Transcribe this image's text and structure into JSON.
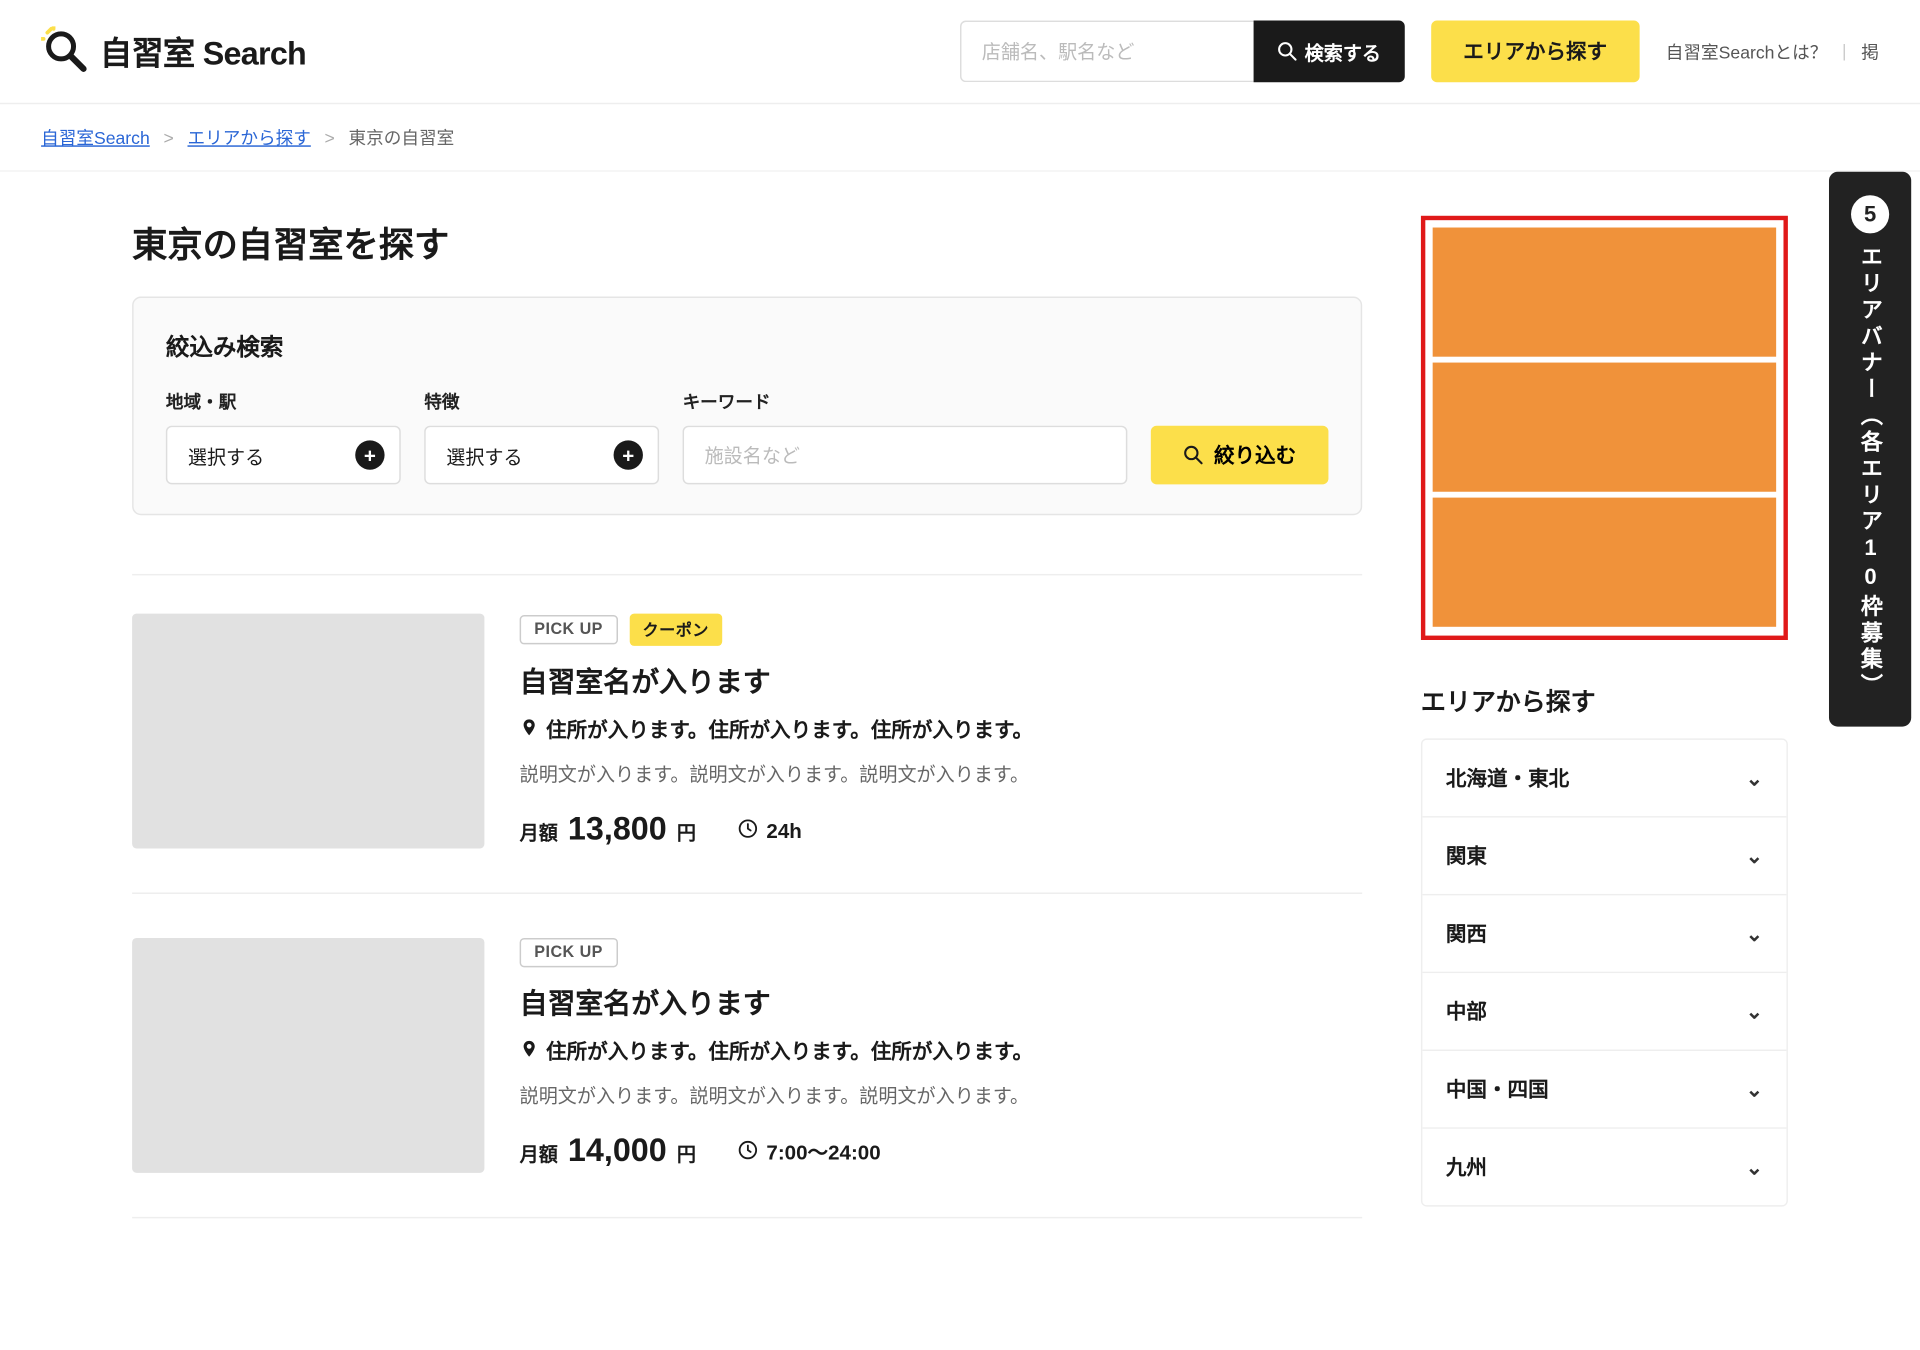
{
  "header": {
    "logo_text": "自習室 Search",
    "search_placeholder": "店舗名、駅名など",
    "search_button": "検索する",
    "area_button": "エリアから探す",
    "nav_about": "自習室Searchとは？",
    "nav_post": "掲"
  },
  "breadcrumb": {
    "home": "自習室Search",
    "area": "エリアから探す",
    "current": "東京の自習室"
  },
  "page_title": "東京の自習室を探す",
  "filter": {
    "title": "絞込み検索",
    "field_area_label": "地域・駅",
    "field_area_value": "選択する",
    "field_feature_label": "特徴",
    "field_feature_value": "選択する",
    "field_keyword_label": "キーワード",
    "field_keyword_placeholder": "施設名など",
    "submit": "絞り込む"
  },
  "listings": [
    {
      "pickup": "PICK UP",
      "coupon": "クーポン",
      "title": "自習室名が入ります",
      "address": "住所が入ります。住所が入ります。住所が入ります。",
      "desc": "説明文が入ります。説明文が入ります。説明文が入ります。",
      "price_label": "月額",
      "price_value": "13,800",
      "price_unit": "円",
      "hours": "24h"
    },
    {
      "pickup": "PICK UP",
      "coupon": "",
      "title": "自習室名が入ります",
      "address": "住所が入ります。住所が入ります。住所が入ります。",
      "desc": "説明文が入ります。説明文が入ります。説明文が入ります。",
      "price_label": "月額",
      "price_value": "14,000",
      "price_unit": "円",
      "hours": "7:00〜24:00"
    }
  ],
  "aside": {
    "title": "エリアから探す",
    "regions": [
      "北海道・東北",
      "関東",
      "関西",
      "中部",
      "中国・四国",
      "九州"
    ]
  },
  "callout": {
    "num": "5",
    "text": "エリアバナー（各エリア10枠募集）"
  }
}
